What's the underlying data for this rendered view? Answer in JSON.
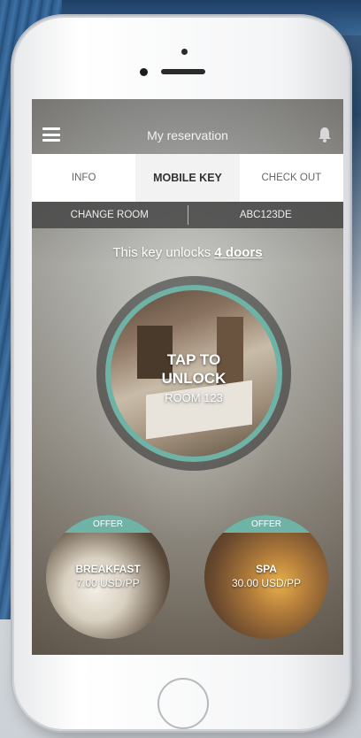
{
  "header": {
    "title": "My reservation",
    "menu_icon": "hamburger-icon",
    "bell_icon": "bell-icon"
  },
  "tabs": [
    {
      "label": "INFO",
      "active": false
    },
    {
      "label": "MOBILE KEY",
      "active": true
    },
    {
      "label": "CHECK OUT",
      "active": false
    }
  ],
  "subbar": {
    "change_room": "CHANGE ROOM",
    "code": "ABC123DE"
  },
  "unlock_info": {
    "prefix": "This key unlocks",
    "doors": "4 doors"
  },
  "key": {
    "line1": "TAP TO",
    "line2": "UNLOCK",
    "room": "ROOM 123"
  },
  "offers": [
    {
      "badge": "OFFER",
      "name": "BREAKFAST",
      "price": "7.00 USD/PP"
    },
    {
      "badge": "OFFER",
      "name": "SPA",
      "price": "30.00 USD/PP"
    }
  ],
  "colors": {
    "accent": "#6fb3a7",
    "tab_active_bg": "#f2f2f2",
    "subbar_bg": "#464646"
  }
}
